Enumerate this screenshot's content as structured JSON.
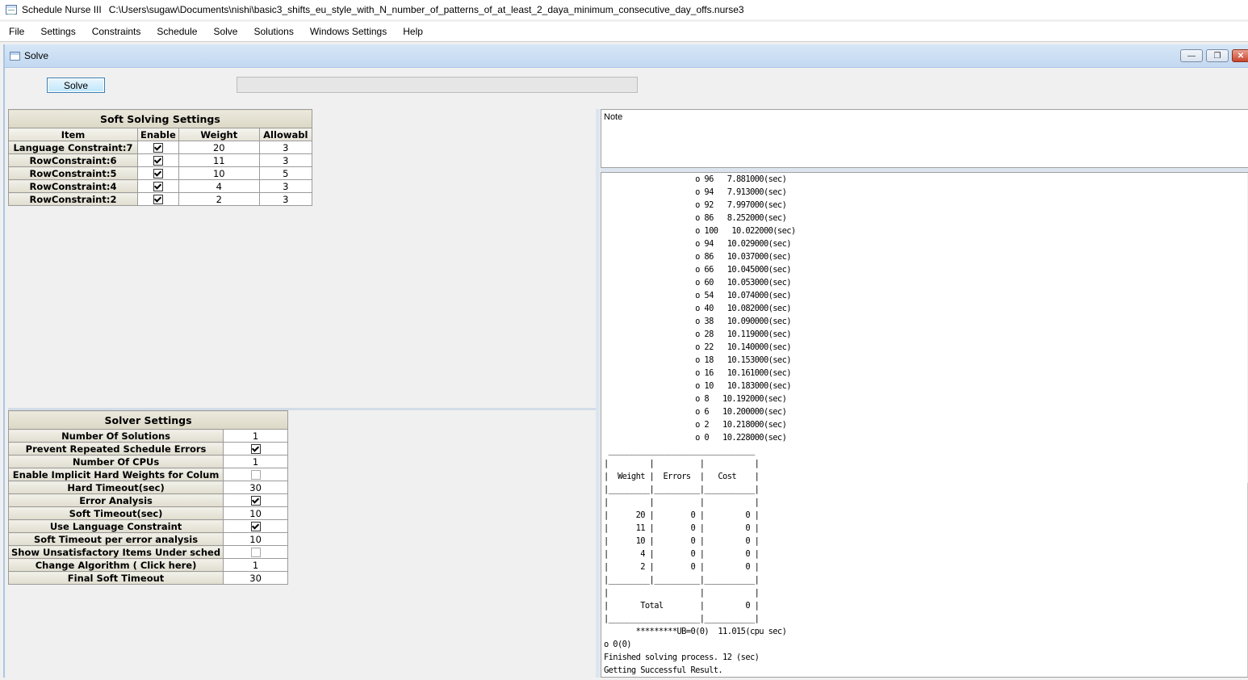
{
  "titlebar": {
    "app_name": "Schedule Nurse III",
    "file_path": "C:\\Users\\sugaw\\Documents\\nishi\\basic3_shifts_eu_style_with_N_number_of_patterns_of_at_least_2_daya_minimum_consecutive_day_offs.nurse3"
  },
  "menu": [
    "File",
    "Settings",
    "Constraints",
    "Schedule",
    "Solve",
    "Solutions",
    "Windows Settings",
    "Help"
  ],
  "child_window": {
    "title": "Solve",
    "minimize": "—",
    "restore": "❐",
    "close": "✕"
  },
  "toolbar": {
    "solve_label": "Solve"
  },
  "soft_settings": {
    "caption": "Soft Solving Settings",
    "headers": [
      "Item",
      "Enable",
      "Weight",
      "Allowabl"
    ],
    "rows": [
      {
        "item": "Language Constraint:7",
        "enabled": true,
        "weight": "20",
        "allowable": "3"
      },
      {
        "item": "RowConstraint:6",
        "enabled": true,
        "weight": "11",
        "allowable": "3"
      },
      {
        "item": "RowConstraint:5",
        "enabled": true,
        "weight": "10",
        "allowable": "5"
      },
      {
        "item": "RowConstraint:4",
        "enabled": true,
        "weight": "4",
        "allowable": "3"
      },
      {
        "item": "RowConstraint:2",
        "enabled": true,
        "weight": "2",
        "allowable": "3"
      }
    ]
  },
  "solver_settings": {
    "caption": "Solver Settings",
    "rows": [
      {
        "label": "Number Of Solutions",
        "type": "text",
        "value": "1"
      },
      {
        "label": "Prevent Repeated Schedule Errors",
        "type": "check",
        "checked": true
      },
      {
        "label": "Number Of CPUs",
        "type": "text",
        "value": "1"
      },
      {
        "label": "Enable Implicit Hard Weights for Colum",
        "type": "check",
        "checked": false
      },
      {
        "label": "Hard Timeout(sec)",
        "type": "text",
        "value": "30"
      },
      {
        "label": "Error Analysis",
        "type": "check",
        "checked": true
      },
      {
        "label": "Soft Timeout(sec)",
        "type": "text",
        "value": "10"
      },
      {
        "label": "Use Language Constraint",
        "type": "check",
        "checked": true
      },
      {
        "label": "Soft Timeout per error analysis",
        "type": "text",
        "value": "10"
      },
      {
        "label": "Show Unsatisfactory Items Under sched",
        "type": "check",
        "checked": false
      },
      {
        "label": "Change Algorithm ( Click here)",
        "type": "text",
        "value": "1"
      },
      {
        "label": "Final Soft Timeout",
        "type": "text",
        "value": "30"
      }
    ]
  },
  "note": {
    "label": "Note"
  },
  "log": {
    "lines": [
      "                    o 96   7.881000(sec)",
      "                    o 94   7.913000(sec)",
      "                    o 92   7.997000(sec)",
      "                    o 86   8.252000(sec)",
      "                    o 100   10.022000(sec)",
      "                    o 94   10.029000(sec)",
      "                    o 86   10.037000(sec)",
      "                    o 66   10.045000(sec)",
      "                    o 60   10.053000(sec)",
      "                    o 54   10.074000(sec)",
      "                    o 40   10.082000(sec)",
      "                    o 38   10.090000(sec)",
      "                    o 28   10.119000(sec)",
      "                    o 22   10.140000(sec)",
      "                    o 18   10.153000(sec)",
      "                    o 16   10.161000(sec)",
      "                    o 10   10.183000(sec)",
      "                    o 8   10.192000(sec)",
      "                    o 6   10.200000(sec)",
      "                    o 2   10.218000(sec)",
      "                    o 0   10.228000(sec)",
      " ________________________________",
      "|         |          |           |",
      "|  Weight |  Errors  |   Cost    |",
      "|_________|__________|___________|",
      "|         |          |           |",
      "|      20 |        0 |         0 |",
      "|      11 |        0 |         0 |",
      "|      10 |        0 |         0 |",
      "|       4 |        0 |         0 |",
      "|       2 |        0 |         0 |",
      "|_________|__________|___________|",
      "|                    |           |",
      "|       Total        |         0 |",
      "|____________________|___________|",
      "       *********UB=0(0)  11.015(cpu sec)",
      "o 0(0)",
      "Finished solving process. 12 (sec)",
      "Getting Successful Result."
    ]
  }
}
